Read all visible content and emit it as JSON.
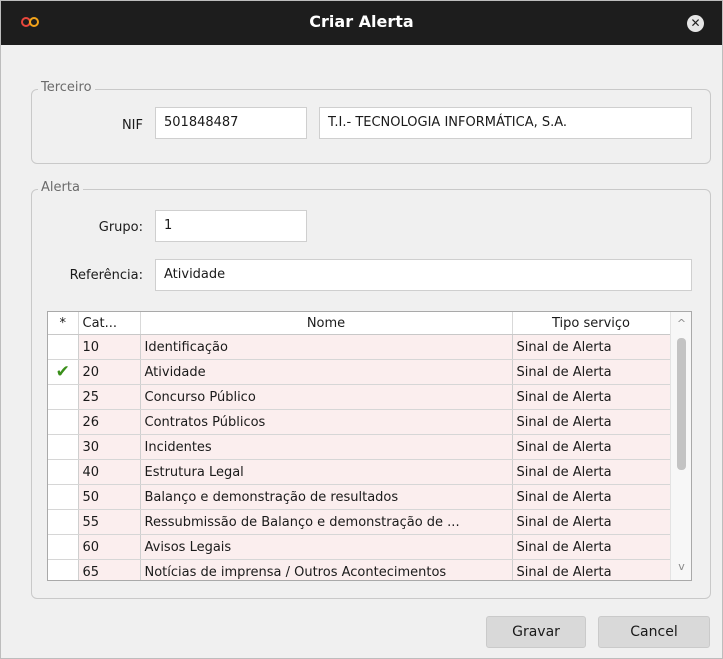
{
  "dialog": {
    "title": "Criar Alerta",
    "close_icon": "✕"
  },
  "terceiro": {
    "legend": "Terceiro",
    "nif_label": "NIF",
    "nif_value": "501848487",
    "name_value": "T.I.- TECNOLOGIA INFORMÁTICA, S.A."
  },
  "alerta": {
    "legend": "Alerta",
    "grupo_label": "Grupo:",
    "grupo_value": "1",
    "referencia_label": "Referência:",
    "referencia_value": "Atividade"
  },
  "grid": {
    "headers": {
      "indicator": "*",
      "cat": "Cat...",
      "nome": "Nome",
      "tipo": "Tipo serviço"
    },
    "rows": [
      {
        "cat": "10",
        "nome": "Identificação",
        "tipo": "Sinal de Alerta",
        "mark": ""
      },
      {
        "cat": "20",
        "nome": "Atividade",
        "tipo": "Sinal de Alerta",
        "mark": "✔"
      },
      {
        "cat": "25",
        "nome": "Concurso Público",
        "tipo": "Sinal de Alerta",
        "mark": ""
      },
      {
        "cat": "26",
        "nome": "Contratos Públicos",
        "tipo": "Sinal de Alerta",
        "mark": ""
      },
      {
        "cat": "30",
        "nome": "Incidentes",
        "tipo": "Sinal de Alerta",
        "mark": ""
      },
      {
        "cat": "40",
        "nome": "Estrutura Legal",
        "tipo": "Sinal de Alerta",
        "mark": ""
      },
      {
        "cat": "50",
        "nome": "Balanço e demonstração de resultados",
        "tipo": "Sinal de Alerta",
        "mark": ""
      },
      {
        "cat": "55",
        "nome": "Ressubmissão de Balanço e demonstração de ...",
        "tipo": "Sinal de Alerta",
        "mark": ""
      },
      {
        "cat": "60",
        "nome": "Avisos Legais",
        "tipo": "Sinal de Alerta",
        "mark": ""
      },
      {
        "cat": "65",
        "nome": "Notícias de imprensa / Outros Acontecimentos",
        "tipo": "Sinal de Alerta",
        "mark": ""
      }
    ],
    "scroll_up_icon": "^",
    "scroll_down_icon": "v"
  },
  "buttons": {
    "gravar": "Gravar",
    "cancel": "Cancel"
  },
  "colors": {
    "titlebar": "#1d1d1d",
    "row_highlight": "#fbeeee",
    "check": "#3a8f1b",
    "logo": "#e8463c"
  }
}
